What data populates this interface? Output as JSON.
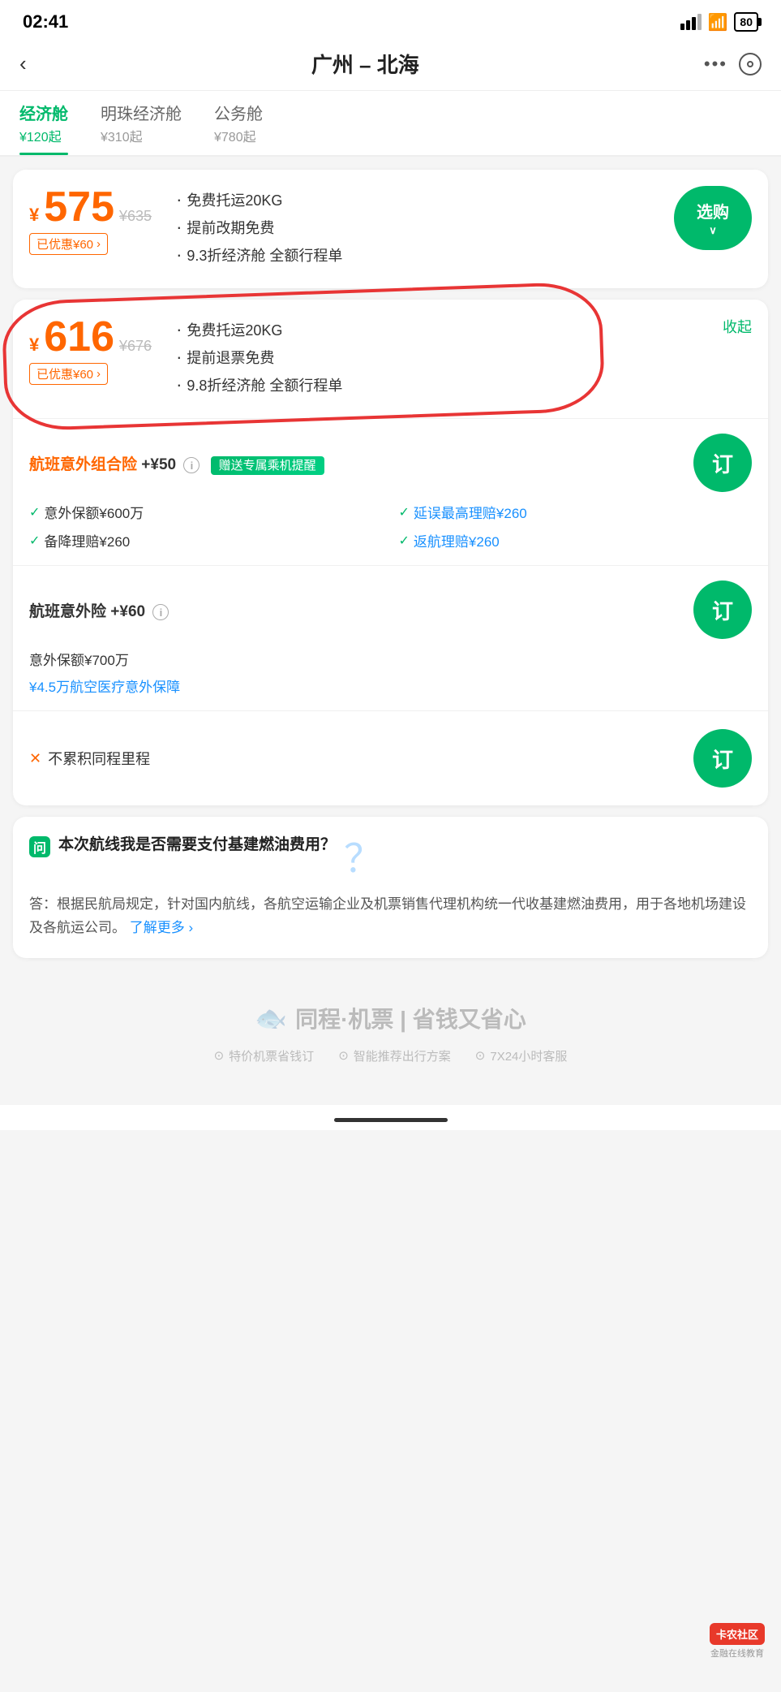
{
  "status": {
    "time": "02:41",
    "battery": "80"
  },
  "header": {
    "back_label": "‹",
    "title": "广州 – 北海",
    "more_label": "•••"
  },
  "tabs": [
    {
      "id": "economy",
      "label": "经济舱",
      "price": "¥120起",
      "active": true
    },
    {
      "id": "pearl_economy",
      "label": "明珠经济舱",
      "price": "¥310起",
      "active": false
    },
    {
      "id": "business",
      "label": "公务舱",
      "price": "¥780起",
      "active": false
    }
  ],
  "card1": {
    "price_symbol": "¥",
    "price_value": "575",
    "price_original": "¥635",
    "discount_label": "已优惠¥60",
    "features": [
      "免费托运20KG",
      "提前改期免费",
      "9.3折经济舱  全额行程单"
    ],
    "select_btn": "选购"
  },
  "card2": {
    "price_symbol": "¥",
    "price_value": "616",
    "price_original": "¥676",
    "discount_label": "已优惠¥60",
    "collapse_label": "收起",
    "features": [
      "免费托运20KG",
      "提前退票免费",
      "9.8折经济舱  全额行程单"
    ],
    "insurance1": {
      "title": "航班意外组合险",
      "plus": "+¥50",
      "info": "i",
      "gift_label": "赠送专属乘机提醒",
      "features": [
        {
          "text": "意外保额¥600万",
          "is_blue": false
        },
        {
          "text": "延误最高理赔¥260",
          "is_blue": true
        },
        {
          "text": "备降理赔¥260",
          "is_blue": false
        },
        {
          "text": "返航理赔¥260",
          "is_blue": true
        }
      ],
      "order_btn": "订"
    },
    "insurance2": {
      "title": "航班意外险",
      "plus": "+¥60",
      "info": "i",
      "features": [
        "意外保额¥700万",
        "¥4.5万航空医疗意外保障"
      ],
      "order_btn": "订"
    },
    "no_mileage": {
      "text": "不累积同程里程",
      "order_btn": "订"
    }
  },
  "faq": {
    "question": "本次航线我是否需要支付基建燃油费用？",
    "answer": "答：根据民航局规定，针对国内航线，各航空运输企业及机票销售代理机构统一代收基建燃油费用，用于各地机场建设及各航运公司。",
    "link_text": "了解更多 ›"
  },
  "footer": {
    "logo_fish": "🐟",
    "logo_text": "同程·机票 | 省钱又省心",
    "features": [
      "特价机票省钱订",
      "智能推荐出行方案",
      "7X24小时客服"
    ]
  },
  "watermark": {
    "label": "卡农社区",
    "sub": "金融在线教育"
  }
}
